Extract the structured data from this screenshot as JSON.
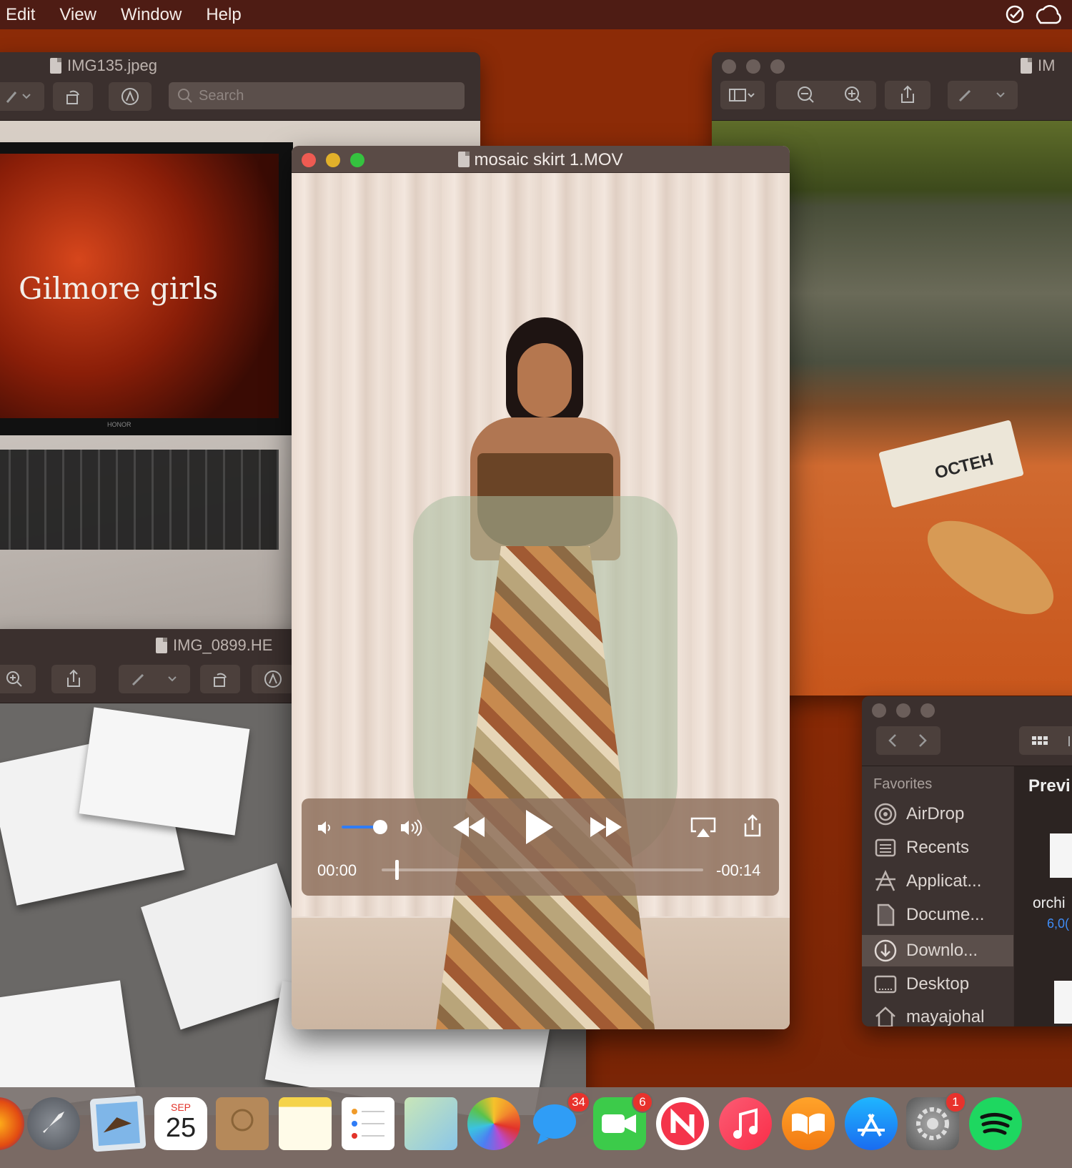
{
  "menubar": {
    "items": [
      "Edit",
      "View",
      "Window",
      "Help"
    ]
  },
  "window_img135": {
    "title": "IMG135.jpeg",
    "search_placeholder": "Search",
    "photo_text": "Gilmore girls",
    "laptop_brand": "HONOR"
  },
  "window_right": {
    "title": "IM",
    "book_text": "ОСТЕН"
  },
  "window_img0899": {
    "title": "IMG_0899.HE"
  },
  "quicktime": {
    "title": "mosaic skirt 1.MOV",
    "time_elapsed": "00:00",
    "time_remaining": "-00:14",
    "volume_level": 0.85,
    "progress": 0.02
  },
  "finder": {
    "section": "Favorites",
    "items": [
      "AirDrop",
      "Recents",
      "Applicat...",
      "Docume...",
      "Downlo...",
      "Desktop",
      "mayajohal"
    ],
    "selected": "Downlo...",
    "preview_header": "Previ",
    "file_name": "orchi",
    "file_size": "6,0("
  },
  "dock": {
    "calendar_month": "SEP",
    "calendar_day": "25",
    "messages_badge": "34",
    "facetime_badge": "6",
    "settings_badge": "1"
  },
  "colors": {
    "desktop": "#8a2a06",
    "menubar": "#4e1c14",
    "accent_blue": "#2f7cf6"
  }
}
